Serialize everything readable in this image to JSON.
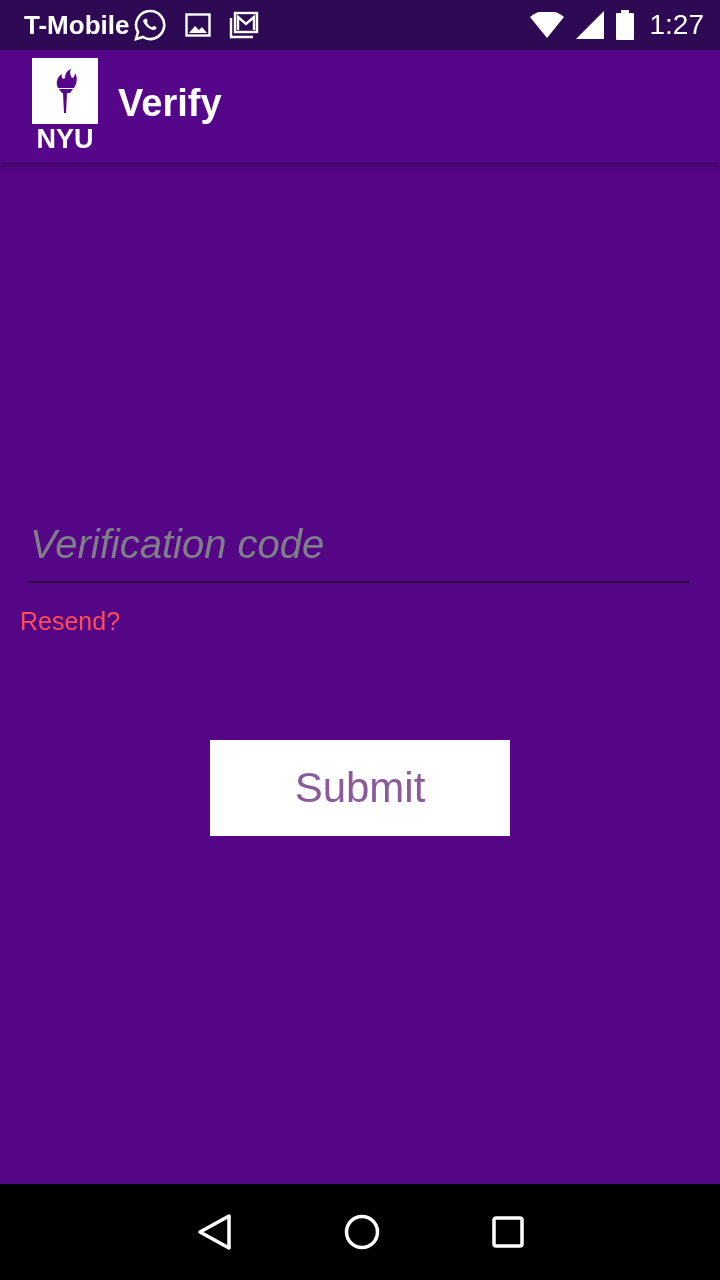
{
  "status_bar": {
    "carrier": "T-Mobile",
    "time": "1:27"
  },
  "app_bar": {
    "logo_text": "NYU",
    "title": "Verify"
  },
  "form": {
    "code_field": {
      "placeholder": "Verification code"
    },
    "resend_link": "Resend?",
    "submit_button": "Submit"
  }
}
